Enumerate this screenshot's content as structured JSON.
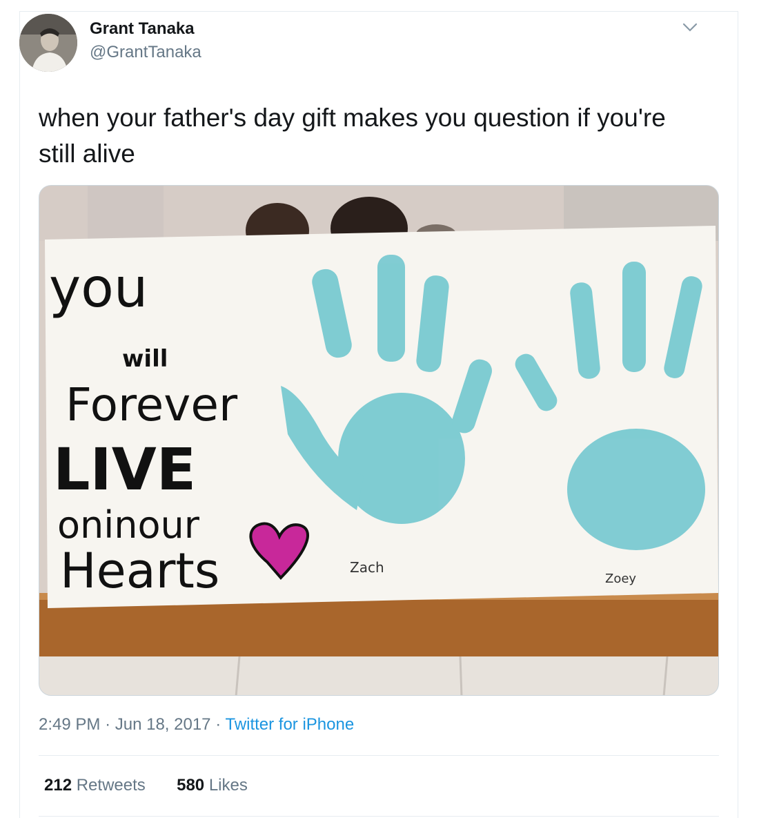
{
  "author": {
    "name": "Grant Tanaka",
    "handle": "@GrantTanaka"
  },
  "tweet": {
    "text": "when your father's day gift makes you question if you're still alive"
  },
  "media": {
    "poster_lines": [
      "you",
      "will",
      "Forever",
      "LIVE",
      "oninour",
      "Hearts"
    ],
    "handprint_labels": [
      "Zach",
      "Zoey"
    ],
    "ink_color": "#6fc9cf",
    "heart_color": "#c8289a"
  },
  "meta": {
    "time": "2:49 PM",
    "separator": "·",
    "date": "Jun 18, 2017",
    "source": "Twitter for iPhone"
  },
  "stats": {
    "retweets_count": "212",
    "retweets_label": "Retweets",
    "likes_count": "580",
    "likes_label": "Likes"
  },
  "icons": [
    "chevron-down-icon"
  ]
}
